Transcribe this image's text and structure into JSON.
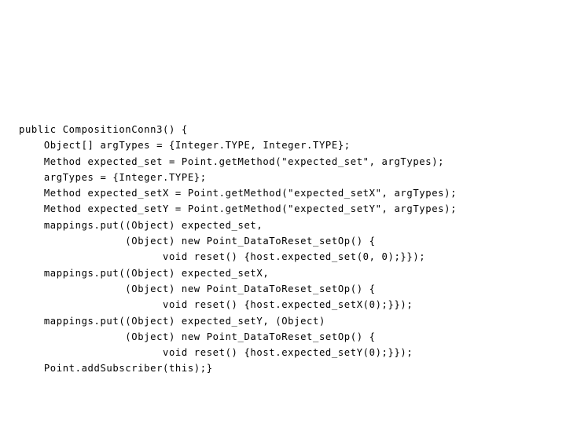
{
  "slide": {
    "background_color": "#ffffff",
    "text_color": "#000000",
    "language": "java"
  },
  "code": {
    "lines": [
      "public CompositionConn3() {",
      "    Object[] argTypes = {Integer.TYPE, Integer.TYPE};",
      "    Method expected_set = Point.getMethod(\"expected_set\", argTypes);",
      "    argTypes = {Integer.TYPE};",
      "    Method expected_setX = Point.getMethod(\"expected_setX\", argTypes);",
      "    Method expected_setY = Point.getMethod(\"expected_setY\", argTypes);",
      "    mappings.put((Object) expected_set,",
      "                 (Object) new Point_DataToReset_setOp() {",
      "                       void reset() {host.expected_set(0, 0);}});",
      "    mappings.put((Object) expected_setX,",
      "                 (Object) new Point_DataToReset_setOp() {",
      "                       void reset() {host.expected_setX(0);}});",
      "    mappings.put((Object) expected_setY, (Object)",
      "                 (Object) new Point_DataToReset_setOp() {",
      "                       void reset() {host.expected_setY(0);}});",
      "    Point.addSubscriber(this);}"
    ]
  }
}
